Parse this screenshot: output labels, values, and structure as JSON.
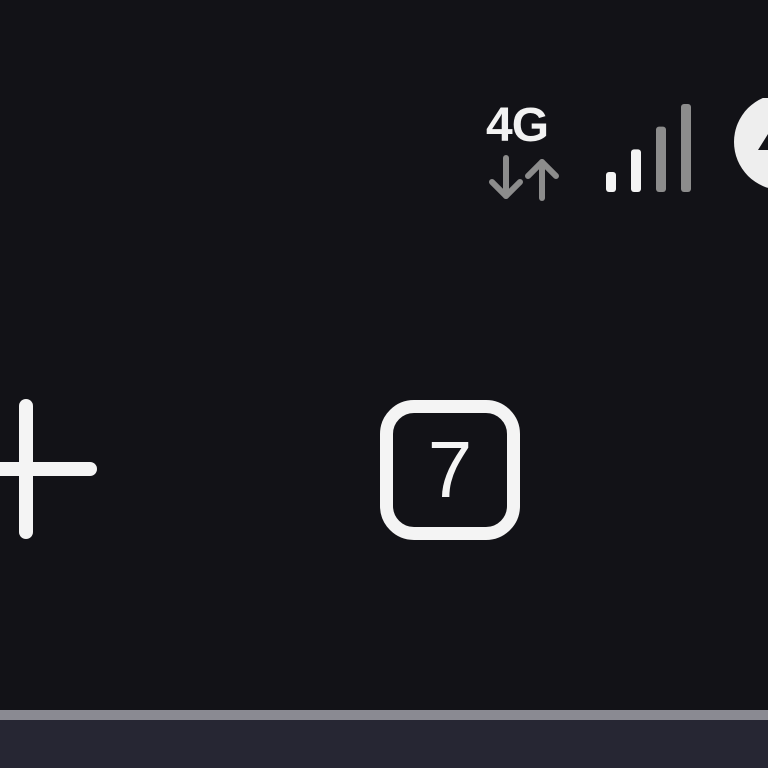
{
  "status_bar": {
    "network_type": "4G",
    "signal_strength": {
      "active_bars": 2,
      "total_bars": 4
    },
    "data_activity_icon": "download-upload-arrows-icon",
    "battery_icon": "battery-charging-icon"
  },
  "toolbar": {
    "new_tab_icon": "plus-icon",
    "tab_count": "7"
  },
  "colors": {
    "background": "#121217",
    "icon": "#f4f4f4",
    "dim_icon": "#8c8c8c",
    "divider": "#8a8a92",
    "bottom_panel": "#262633"
  }
}
